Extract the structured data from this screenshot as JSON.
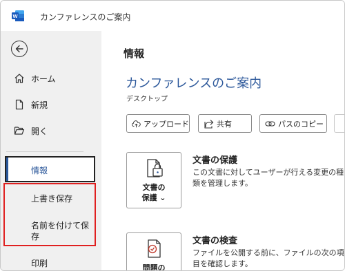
{
  "titlebar": {
    "app_icon": "word-logo",
    "title": "カンファレンスのご案内"
  },
  "nav": {
    "back_icon": "back-arrow-icon",
    "items": [
      {
        "label": "ホーム",
        "icon": "home-icon"
      },
      {
        "label": "新規",
        "icon": "new-document-icon"
      },
      {
        "label": "開く",
        "icon": "open-folder-icon"
      }
    ],
    "selected": "情報",
    "save_label": "上書き保存",
    "save_as_label_line1": "名前を付けて保",
    "save_as_label_line2": "存",
    "print_label": "印刷"
  },
  "main": {
    "heading": "情報",
    "doc_title": "カンファレンスのご案内",
    "doc_location": "デスクトップ",
    "buttons": {
      "upload": "アップロード",
      "share": "共有",
      "copy_path": "パスのコピー"
    },
    "protect": {
      "card_line1": "文書の",
      "card_line2": "保護 ⌄",
      "title": "文書の保護",
      "desc": "この文書に対してユーザーが行える変更の種類を管理します。"
    },
    "inspect": {
      "card_line1": "問題の",
      "title": "文書の検査",
      "desc": "ファイルを公開する前に、ファイルの次の項目を確認します。"
    }
  },
  "colors": {
    "accent": "#2b579a",
    "highlight_box": "#e02020",
    "left_pane_bg": "#f0f0f0"
  }
}
